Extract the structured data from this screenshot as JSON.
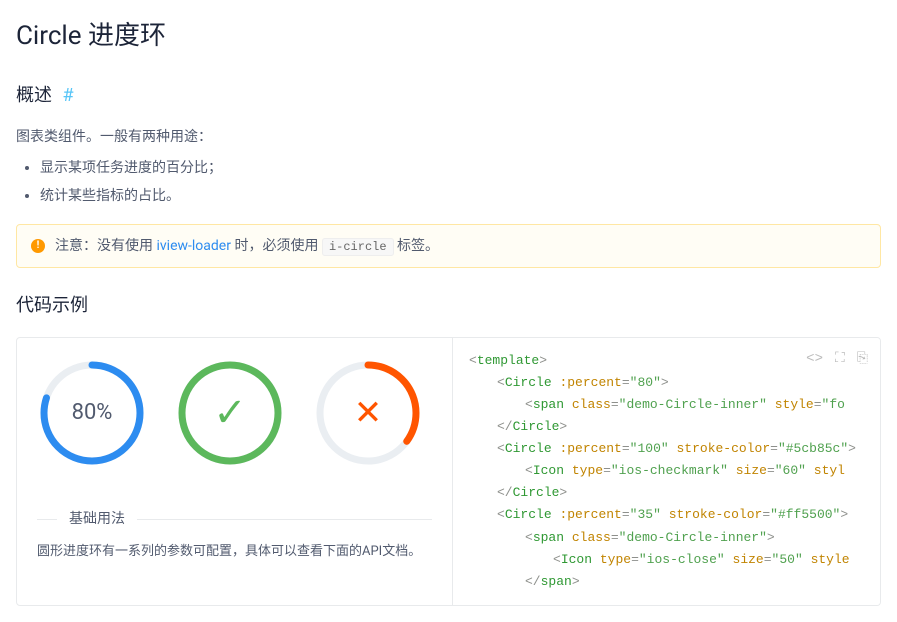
{
  "title": "Circle 进度环",
  "overview": {
    "heading": "概述",
    "anchor": "#",
    "intro": "图表类组件。一般有两种用途：",
    "bullets": [
      "显示某项任务进度的百分比；",
      "统计某些指标的占比。"
    ]
  },
  "alert": {
    "prefix": "注意：没有使用",
    "link": "iview-loader",
    "mid": "时，必须使用",
    "code": "i-circle",
    "suffix": "标签。"
  },
  "examples_heading": "代码示例",
  "demo": {
    "title": "基础用法",
    "desc": "圆形进度环有一系列的参数可配置，具体可以查看下面的API文档。",
    "circles": [
      {
        "percent": 80,
        "stroke": "#2d8cf0",
        "centerText": "80%"
      },
      {
        "percent": 100,
        "stroke": "#5cb85c",
        "centerIcon": "check"
      },
      {
        "percent": 35,
        "stroke": "#ff5500",
        "centerIcon": "close"
      }
    ]
  },
  "code": {
    "l1_tag": "template",
    "l2_tag": "Circle",
    "l2_attr": ":percent",
    "l2_val": "\"80\"",
    "l3_tag": "span",
    "l3_a1": "class",
    "l3_v1": "\"demo-Circle-inner\"",
    "l3_a2": "style",
    "l3_v2": "\"fo",
    "l4_tag": "Circle",
    "l5_tag": "Circle",
    "l5_a1": ":percent",
    "l5_v1": "\"100\"",
    "l5_a2": "stroke-color",
    "l5_v2": "\"#5cb85c\"",
    "l6_tag": "Icon",
    "l6_a1": "type",
    "l6_v1": "\"ios-checkmark\"",
    "l6_a2": "size",
    "l6_v2": "\"60\"",
    "l6_a3": "styl",
    "l7_tag": "Circle",
    "l8_tag": "Circle",
    "l8_a1": ":percent",
    "l8_v1": "\"35\"",
    "l8_a2": "stroke-color",
    "l8_v2": "\"#ff5500\"",
    "l9_tag": "span",
    "l9_a1": "class",
    "l9_v1": "\"demo-Circle-inner\"",
    "l10_tag": "Icon",
    "l10_a1": "type",
    "l10_v1": "\"ios-close\"",
    "l10_a2": "size",
    "l10_v2": "\"50\"",
    "l10_a3": "style",
    "l11_tag": "span"
  },
  "tools": {
    "code": "<>",
    "expand": "⛶",
    "copy": "⎘"
  }
}
